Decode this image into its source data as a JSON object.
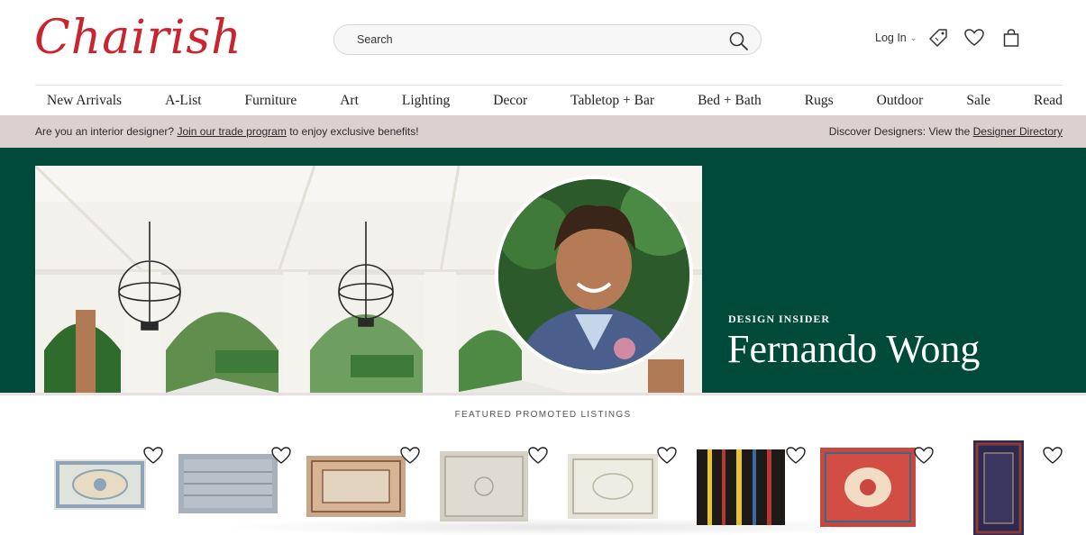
{
  "header": {
    "logo_text": "Chairish",
    "search_placeholder": "Search",
    "login_label": "Log In",
    "brand_color": "#c8262f"
  },
  "nav": {
    "items": [
      "New Arrivals",
      "A-List",
      "Furniture",
      "Art",
      "Lighting",
      "Decor",
      "Tabletop + Bar",
      "Bed + Bath",
      "Rugs",
      "Outdoor",
      "Sale",
      "Read"
    ]
  },
  "promo_bar": {
    "left_prefix": "Are you an interior designer?",
    "left_link": "Join our trade program",
    "left_suffix": "to enjoy exclusive benefits!",
    "right_prefix": "Discover Designers: View the",
    "right_link": "Designer Directory",
    "background": "#ddd1cf"
  },
  "hero": {
    "eyebrow": "DESIGN INSIDER",
    "title": "Fernando Wong",
    "background": "#004a3a"
  },
  "featured": {
    "label": "FEATURED PROMOTED LISTINGS",
    "items": [
      {
        "name": "listing-1",
        "colors": [
          "#dfe3dc",
          "#8da4b8",
          "#c9b48f"
        ]
      },
      {
        "name": "listing-2",
        "colors": [
          "#a7b1bc",
          "#6f7b88",
          "#d5dbe0"
        ]
      },
      {
        "name": "listing-3",
        "colors": [
          "#c8a88a",
          "#8c5e45",
          "#e3d4bf"
        ]
      },
      {
        "name": "listing-4",
        "colors": [
          "#d4d0c6",
          "#a8a497",
          "#e8e6df"
        ]
      },
      {
        "name": "listing-5",
        "colors": [
          "#e4e2d6",
          "#b8b59e",
          "#f2f1ea"
        ]
      },
      {
        "name": "listing-6",
        "colors": [
          "#1d1a17",
          "#e8c42d",
          "#b8382e"
        ]
      },
      {
        "name": "listing-7",
        "colors": [
          "#c9473e",
          "#f2dcc4",
          "#3a6a8a"
        ]
      },
      {
        "name": "listing-8",
        "colors": [
          "#2c2a4f",
          "#8e3a34",
          "#c9a783"
        ]
      }
    ]
  }
}
